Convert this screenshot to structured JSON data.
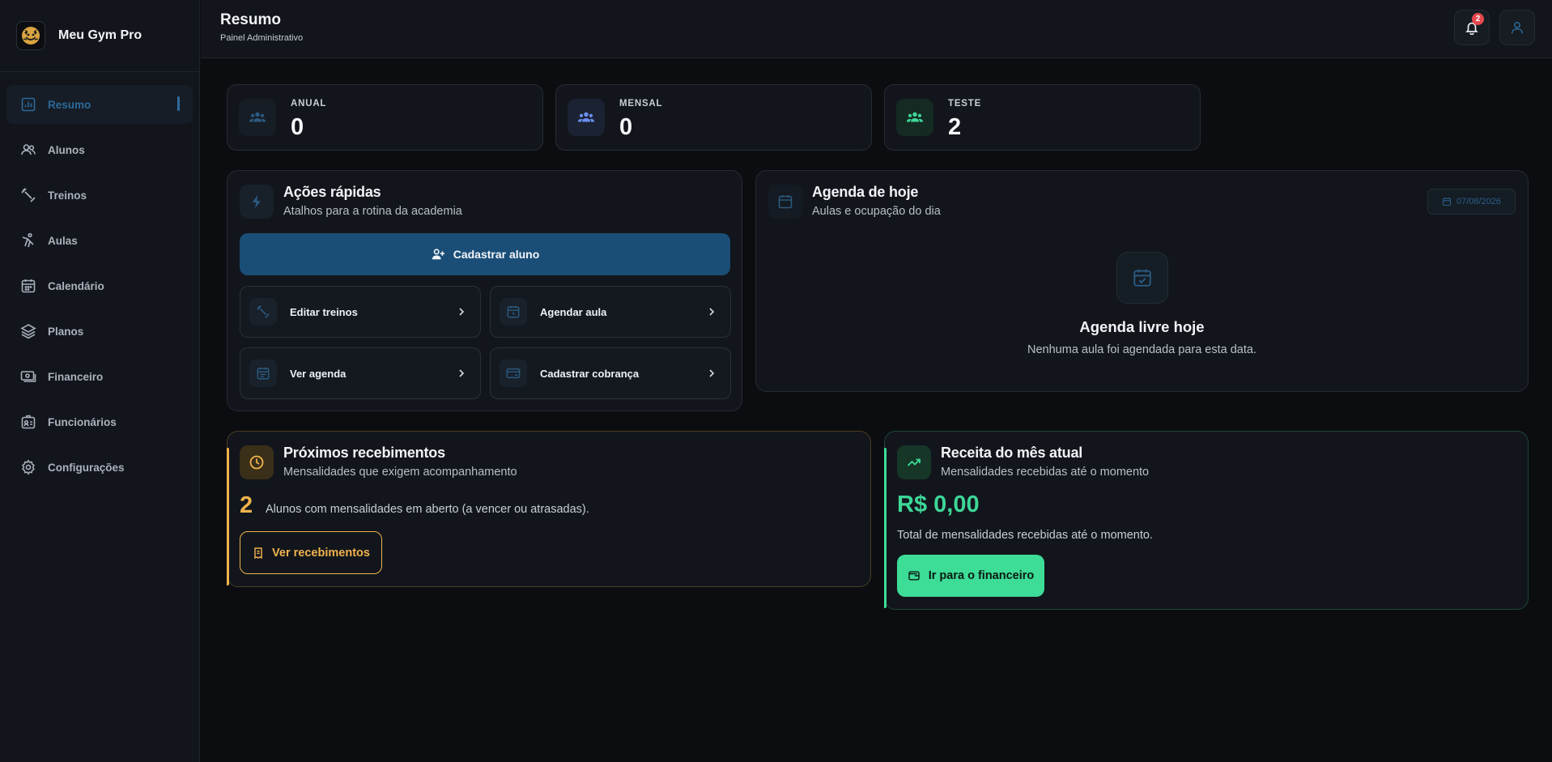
{
  "brand": {
    "name": "Meu Gym Pro"
  },
  "nav": {
    "items": [
      {
        "label": "Resumo",
        "icon": "chart-icon",
        "active": true
      },
      {
        "label": "Alunos",
        "icon": "users-icon"
      },
      {
        "label": "Treinos",
        "icon": "dumbbell-icon"
      },
      {
        "label": "Aulas",
        "icon": "karate-icon"
      },
      {
        "label": "Calendário",
        "icon": "calendar-icon"
      },
      {
        "label": "Planos",
        "icon": "layers-icon"
      },
      {
        "label": "Financeiro",
        "icon": "money-icon"
      },
      {
        "label": "Funcionários",
        "icon": "id-badge-icon"
      },
      {
        "label": "Configurações",
        "icon": "gear-icon"
      }
    ]
  },
  "header": {
    "title": "Resumo",
    "subtitle": "Painel Administrativo",
    "notification_count": "2"
  },
  "stats": [
    {
      "label": "ANUAL",
      "value": "0",
      "color": "#2a5a80"
    },
    {
      "label": "MENSAL",
      "value": "0",
      "color": "#6b8ff0"
    },
    {
      "label": "TESTE",
      "value": "2",
      "color": "#3dd697"
    }
  ],
  "quick_actions": {
    "title": "Ações rápidas",
    "subtitle": "Atalhos para a rotina da academia",
    "primary_label": "Cadastrar aluno",
    "items": [
      {
        "label": "Editar treinos",
        "icon": "dumbbell-icon"
      },
      {
        "label": "Agendar aula",
        "icon": "calendar-clock-icon"
      },
      {
        "label": "Ver agenda",
        "icon": "calendar-icon"
      },
      {
        "label": "Cadastrar cobrança",
        "icon": "credit-card-icon"
      }
    ]
  },
  "agenda": {
    "title": "Agenda de hoje",
    "subtitle": "Aulas e ocupação do dia",
    "date": "07/08/2026",
    "empty_title": "Agenda livre hoje",
    "empty_sub": "Nenhuma aula foi agendada para esta data."
  },
  "receivables": {
    "title": "Próximos recebimentos",
    "subtitle": "Mensalidades que exigem acompanhamento",
    "count": "2",
    "count_text": "Alunos com mensalidades em aberto (a vencer ou atrasadas).",
    "button_label": "Ver recebimentos",
    "accent": "#f0b24c"
  },
  "revenue": {
    "title": "Receita do mês atual",
    "subtitle": "Mensalidades recebidas até o momento",
    "amount": "R$ 0,00",
    "amount_sub": "Total de mensalidades recebidas até o momento.",
    "button_label": "Ir para o financeiro",
    "accent": "#3ddc97"
  }
}
